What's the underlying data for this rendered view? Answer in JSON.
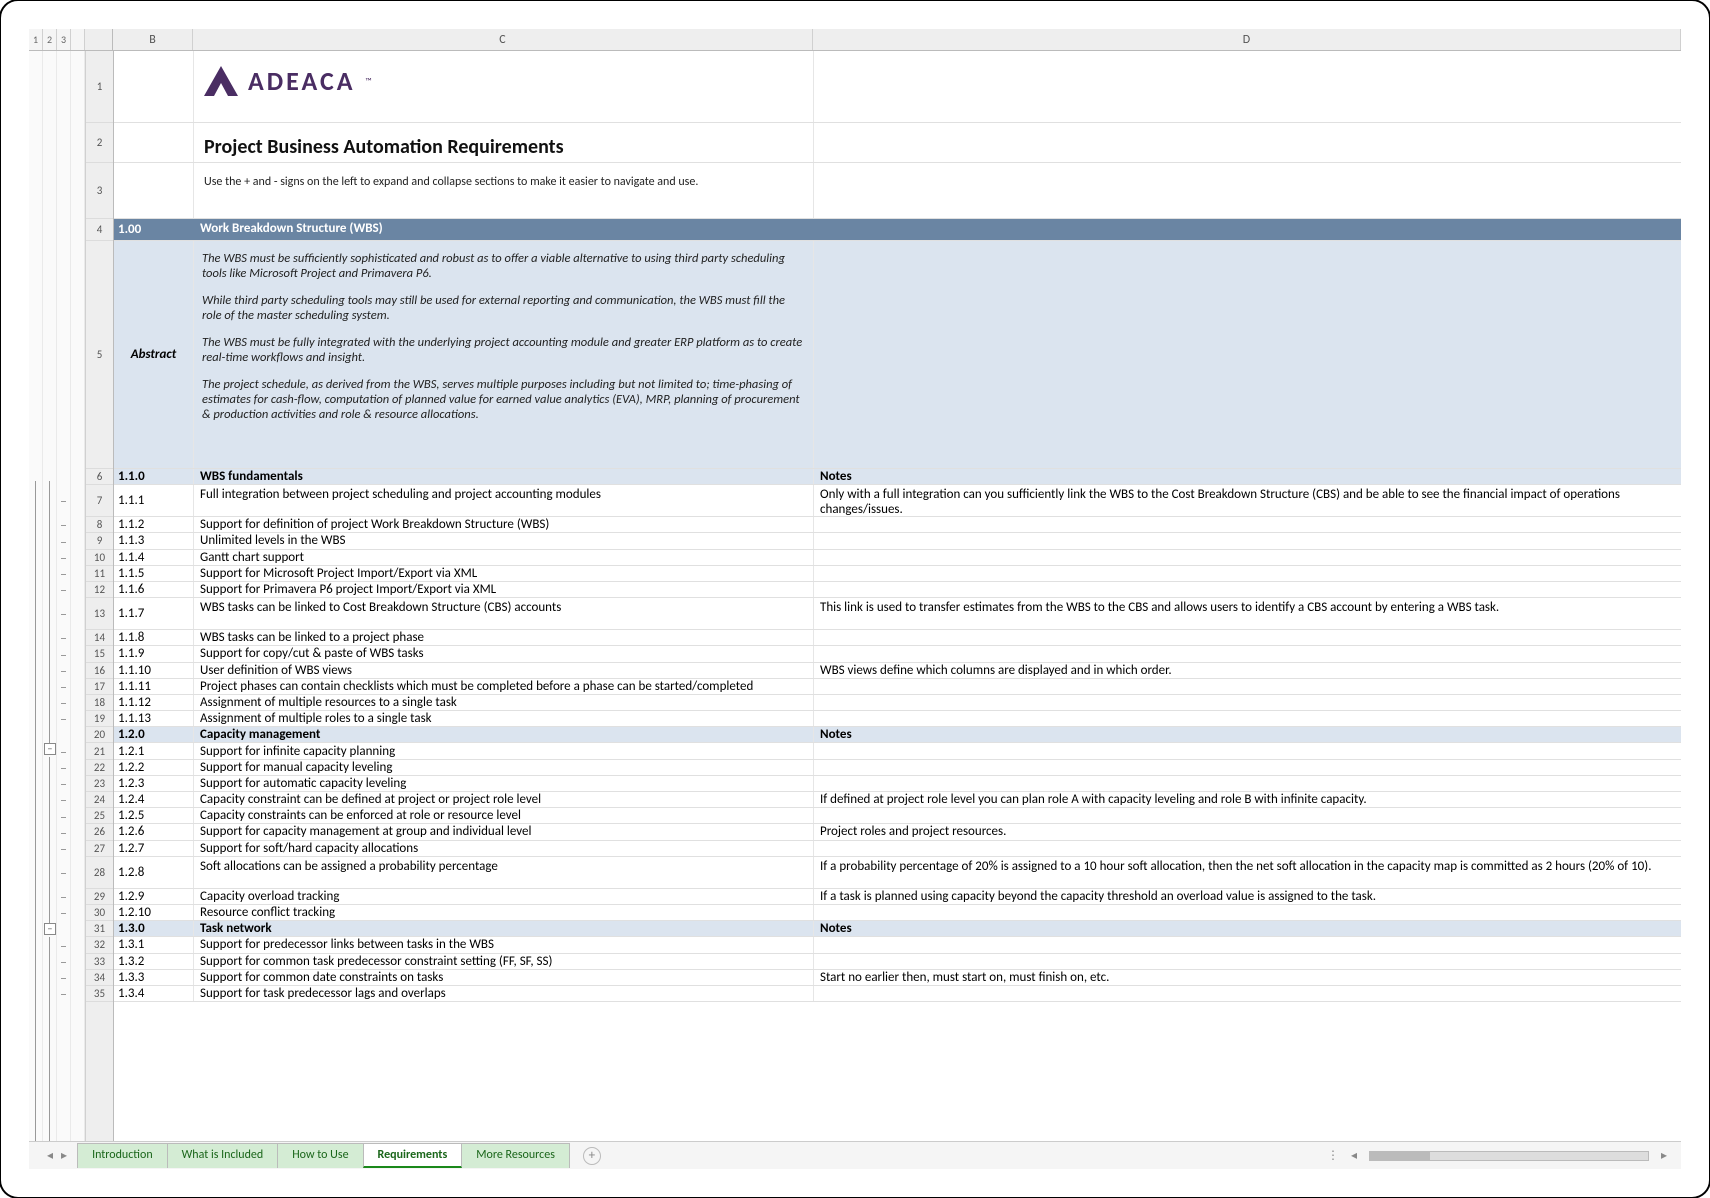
{
  "outline_levels": [
    "1",
    "2",
    "3"
  ],
  "columns": {
    "B": "B",
    "C": "C",
    "D": "D"
  },
  "logo_text": "ADEACA",
  "title": "Project Business Automation Requirements",
  "hint": "Use the + and - signs on the left to expand and collapse sections to make it easier to navigate and use.",
  "main_section": {
    "num": "1.00",
    "title": "Work Breakdown Structure (WBS)"
  },
  "abstract_label": "Abstract",
  "abstract": [
    "The WBS must be sufficiently sophisticated and robust as to offer a viable alternative to using third party scheduling tools like Microsoft Project and Primavera P6.",
    "While third party scheduling tools may still be used for external reporting and communication, the WBS must fill the role of the master scheduling system.",
    "The WBS must be fully integrated with the underlying project accounting module and greater ERP platform as to create real-time workflows and insight.",
    "The project schedule, as derived from the WBS, serves multiple purposes including but not limited to; time-phasing of estimates for cash-flow, computation of planned value for earned value analytics (EVA), MRP,  planning of procurement & production activities and role & resource allocations."
  ],
  "notes_header": "Notes",
  "sections": [
    {
      "row": 6,
      "num": "1.1.0",
      "title": "WBS fundamentals",
      "items": [
        {
          "row": 7,
          "num": "1.1.1",
          "c": "Full integration between project scheduling and project accounting modules",
          "d": "Only with a full integration can you sufficiently link the WBS to the Cost Breakdown Structure (CBS) and be able to see the financial impact of operations changes/issues.",
          "tall": true
        },
        {
          "row": 8,
          "num": "1.1.2",
          "c": "Support for definition of project Work Breakdown Structure (WBS)",
          "d": ""
        },
        {
          "row": 9,
          "num": "1.1.3",
          "c": "Unlimited levels in the WBS",
          "d": ""
        },
        {
          "row": 10,
          "num": "1.1.4",
          "c": "Gantt chart support",
          "d": ""
        },
        {
          "row": 11,
          "num": "1.1.5",
          "c": "Support for Microsoft Project Import/Export via XML",
          "d": ""
        },
        {
          "row": 12,
          "num": "1.1.6",
          "c": "Support for Primavera P6 project Import/Export via XML",
          "d": ""
        },
        {
          "row": 13,
          "num": "1.1.7",
          "c": "WBS tasks can be linked to Cost Breakdown Structure (CBS) accounts",
          "d": "This link is used to transfer estimates from the WBS to the CBS and allows users to identify a CBS account by entering a WBS task.",
          "tall": true
        },
        {
          "row": 14,
          "num": "1.1.8",
          "c": "WBS tasks can be linked to a project phase",
          "d": ""
        },
        {
          "row": 15,
          "num": "1.1.9",
          "c": "Support for copy/cut & paste of WBS tasks",
          "d": ""
        },
        {
          "row": 16,
          "num": "1.1.10",
          "c": "User definition of WBS views",
          "d": "WBS views define which columns are displayed and in which order."
        },
        {
          "row": 17,
          "num": "1.1.11",
          "c": "Project phases can contain checklists which must be completed before a phase can be started/completed",
          "d": ""
        },
        {
          "row": 18,
          "num": "1.1.12",
          "c": "Assignment of multiple resources to a single task",
          "d": ""
        },
        {
          "row": 19,
          "num": "1.1.13",
          "c": "Assignment of multiple roles to a single task",
          "d": ""
        }
      ]
    },
    {
      "row": 20,
      "num": "1.2.0",
      "title": "Capacity management",
      "items": [
        {
          "row": 21,
          "num": "1.2.1",
          "c": "Support for infinite capacity planning",
          "d": ""
        },
        {
          "row": 22,
          "num": "1.2.2",
          "c": "Support for manual capacity leveling",
          "d": ""
        },
        {
          "row": 23,
          "num": "1.2.3",
          "c": "Support for automatic capacity leveling",
          "d": ""
        },
        {
          "row": 24,
          "num": "1.2.4",
          "c": "Capacity constraint can be defined at project or project role level",
          "d": "If defined at project role level you can plan role A with capacity leveling and role B with infinite capacity."
        },
        {
          "row": 25,
          "num": "1.2.5",
          "c": "Capacity constraints can be enforced at role or resource level",
          "d": ""
        },
        {
          "row": 26,
          "num": "1.2.6",
          "c": "Support for capacity management at group and individual level",
          "d": "Project roles and project resources."
        },
        {
          "row": 27,
          "num": "1.2.7",
          "c": "Support for soft/hard capacity allocations",
          "d": ""
        },
        {
          "row": 28,
          "num": "1.2.8",
          "c": "Soft allocations can be assigned a probability percentage",
          "d": "If a probability percentage of 20% is assigned to a 10 hour soft allocation, then the net soft allocation in the capacity map is committed as 2 hours (20% of 10).",
          "tall": true
        },
        {
          "row": 29,
          "num": "1.2.9",
          "c": "Capacity overload tracking",
          "d": "If a task is planned using capacity beyond the capacity threshold an overload value is assigned to the task."
        },
        {
          "row": 30,
          "num": "1.2.10",
          "c": "Resource conflict tracking",
          "d": ""
        }
      ]
    },
    {
      "row": 31,
      "num": "1.3.0",
      "title": "Task network",
      "items": [
        {
          "row": 32,
          "num": "1.3.1",
          "c": "Support for predecessor links between tasks in the WBS",
          "d": ""
        },
        {
          "row": 33,
          "num": "1.3.2",
          "c": "Support for common task predecessor constraint setting (FF, SF, SS)",
          "d": ""
        },
        {
          "row": 34,
          "num": "1.3.3",
          "c": "Support for common date constraints on tasks",
          "d": "Start no earlier then, must start on, must finish on, etc."
        },
        {
          "row": 35,
          "num": "1.3.4",
          "c": "Support for task predecessor lags and overlaps",
          "d": ""
        }
      ]
    }
  ],
  "tabs": [
    "Introduction",
    "What is Included",
    "How to Use",
    "Requirements",
    "More Resources"
  ],
  "active_tab": 3,
  "glyphs": {
    "left": "◂",
    "right": "▸",
    "ellipsis": "⋯",
    "plus": "+",
    "minus": "−"
  }
}
